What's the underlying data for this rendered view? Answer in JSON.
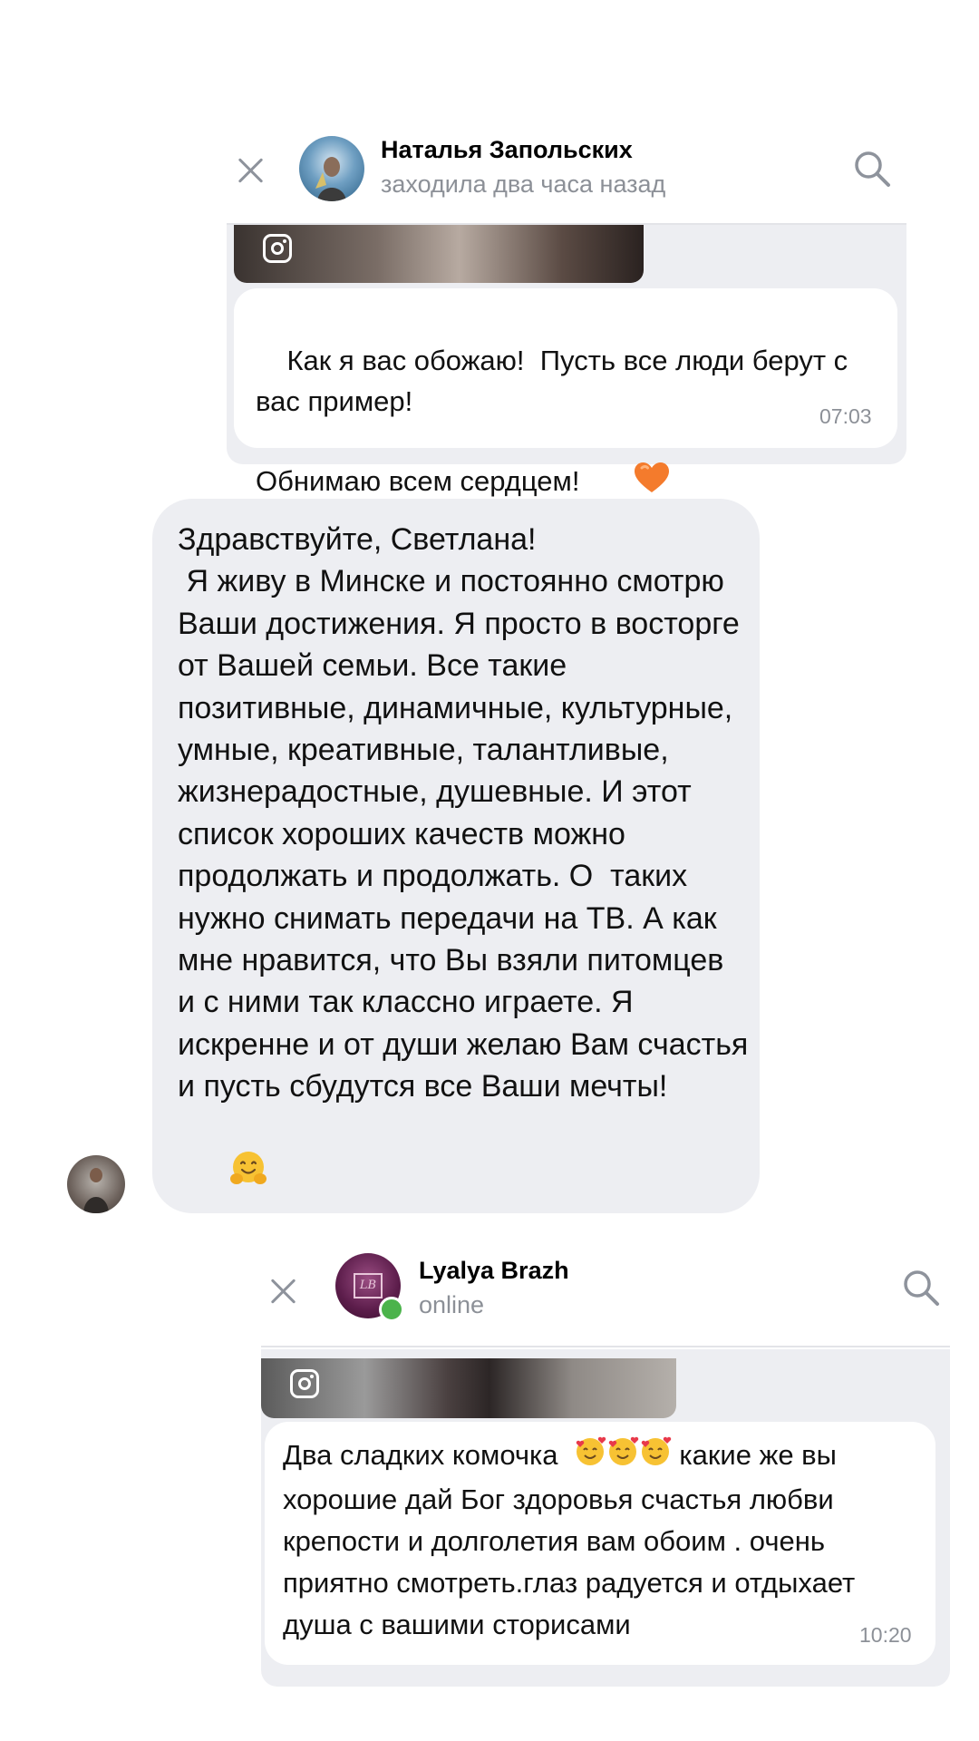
{
  "chat1": {
    "name": "Наталья Запольских",
    "status": "заходила два часа назад",
    "message": "Как я вас обожаю!  Пусть все люди берут с вас пример!\nОбнимаю всем сердцем! ",
    "time": "07:03",
    "icons": [
      "close-icon",
      "search-icon",
      "instagram-icon",
      "orange-heart-emoji"
    ]
  },
  "message2": {
    "text": "Здравствуйте, Светлана!\n Я живу в Минске и постоянно смотрю Ваши достижения. Я просто в восторге от Вашей семьи. Все такие позитивные, динамичные, культурные, умные, креативные, талантливые, жизнерадостные, душевные. И этот список хороших качеств можно продолжать и продолжать. О  таких нужно снимать передачи на ТВ. А как мне нравится, что Вы взяли питомцев и с ними так классно играете. Я искренне и от души желаю Вам счастья и пусть сбудутся все Ваши мечты! ",
    "icons": [
      "hugging-face-emoji"
    ]
  },
  "chat2": {
    "name": "Lyalya Brazh",
    "status": "online",
    "avatar_monogram": "LB",
    "message": "Два сладких комочка  ",
    "message_rest": " какие же вы хорошие дай Бог здоровья счастья любви крепости и долголетия вам обоим . очень приятно смотреть.глаз радуется и отдыхает душа с вашими сторисами",
    "time": "10:20",
    "online_color": "#4bb34b",
    "icons": [
      "close-icon",
      "search-icon",
      "instagram-icon",
      "smiling-face-with-hearts-emoji"
    ]
  }
}
